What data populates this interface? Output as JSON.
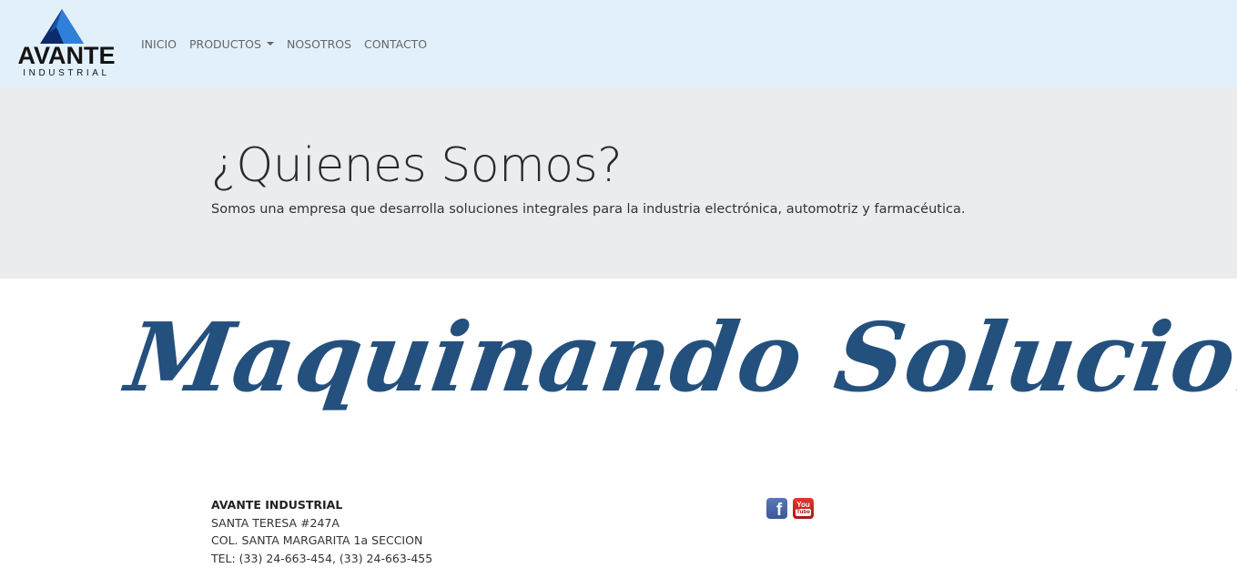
{
  "brand": {
    "name": "AVANTE",
    "subtitle": "INDUSTRIAL",
    "colors": {
      "logo_dark": "#0d2a6b",
      "logo_light": "#2f80d8",
      "text": "#141414"
    }
  },
  "nav": {
    "items": [
      {
        "label": "INICIO"
      },
      {
        "label": "PRODUCTOS",
        "has_dropdown": true
      },
      {
        "label": "NOSOTROS"
      },
      {
        "label": "CONTACTO"
      }
    ],
    "background": "#e2f0fc"
  },
  "jumbotron": {
    "title": "¿Quienes Somos?",
    "text": "Somos una empresa que desarrolla soluciones integrales para la industria electrónica, automotriz y farmacéutica.",
    "background": "#ebeced"
  },
  "banner": {
    "text": "Maquinando Soluciones",
    "color": "#24507d"
  },
  "footer": {
    "company": "AVANTE INDUSTRIAL",
    "address_line1": "SANTA TERESA #247A",
    "address_line2": "COL. SANTA MARGARITA 1a SECCION",
    "phone": "TEL: (33) 24-663-454, (33) 24-663-455",
    "social": [
      {
        "icon": "facebook-icon",
        "glyph": "f"
      },
      {
        "icon": "youtube-icon",
        "top": "You",
        "bottom": "Tube"
      }
    ]
  }
}
